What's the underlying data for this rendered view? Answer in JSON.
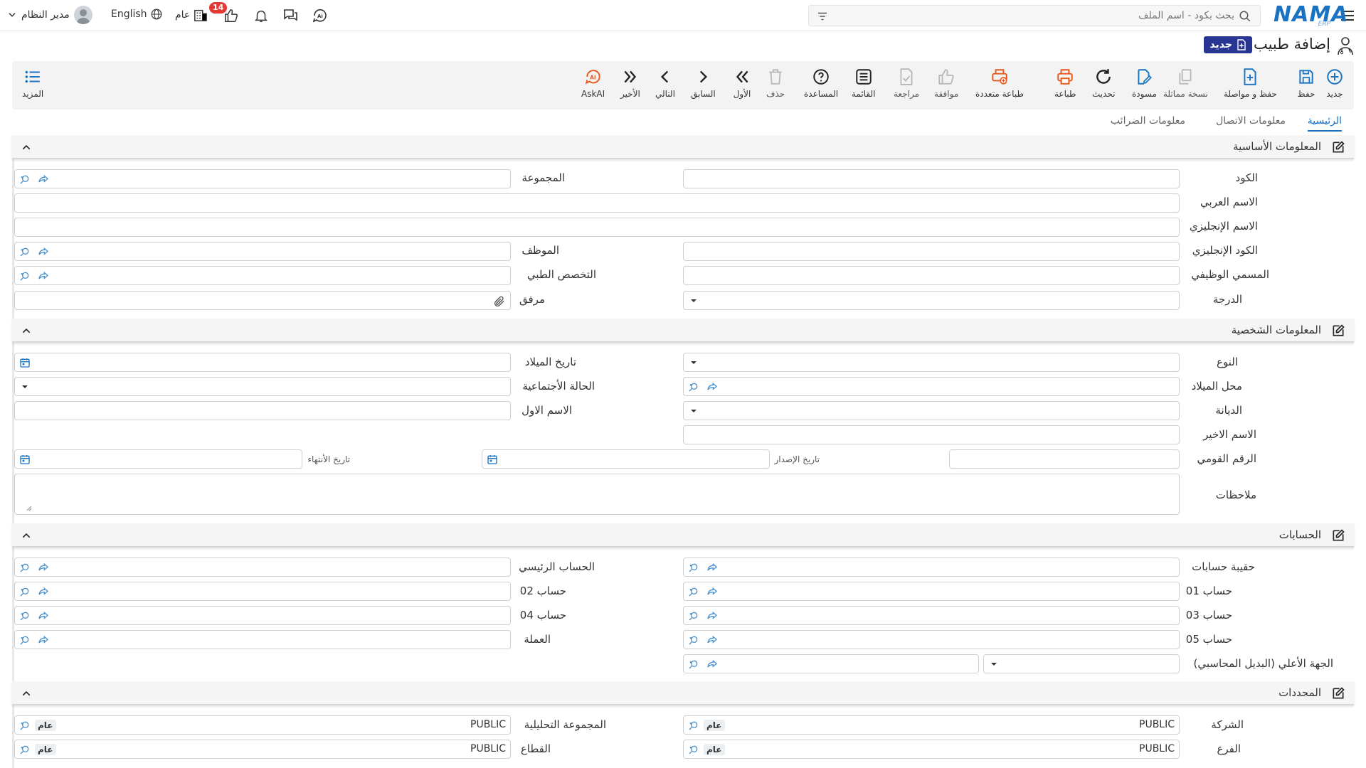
{
  "topbar": {
    "logo_text": "NAMA",
    "logo_sub": "ERP",
    "search_placeholder": "بحث بكود - اسم الملف",
    "notif_count": "14",
    "year_label": "عام",
    "language": "English",
    "user_name": "مدير النظام"
  },
  "page": {
    "title": "إضافة طبيب",
    "new_badge": "جديد"
  },
  "toolbar": {
    "new": "جديد",
    "save": "حفظ",
    "save_continue": "حفظ و مواصلة",
    "copy": "نسخة مماثلة",
    "draft": "مسودة",
    "refresh": "تحديث",
    "print": "طباعة",
    "multi_print": "طباعة متعددة",
    "approve": "موافقة",
    "review": "مراجعة",
    "list": "القائمة",
    "help": "المساعدة",
    "delete": "حذف",
    "first": "الأول",
    "previous": "السابق",
    "next": "التالي",
    "last": "الأخير",
    "askai": "AskAI",
    "more": "المزيد"
  },
  "tabs": [
    "الرئيسية",
    "معلومات الاتصال",
    "معلومات الضرائب"
  ],
  "sections": {
    "basic": "المعلومات الأساسية",
    "personal": "المعلومات الشخصية",
    "accounts": "الحسابات",
    "dimensions": "المحددات"
  },
  "basic_fields": {
    "code": "الكود",
    "group": "المجموعة",
    "arabic_name": "الاسم العربي",
    "english_name": "الاسم الإنجليزي",
    "english_code": "الكود الإنجليزي",
    "employee": "الموظف",
    "job_title": "المسمي الوظيفي",
    "specialty": "التخصص الطبي",
    "degree": "الدرجة",
    "attachment": "مرفق"
  },
  "personal_fields": {
    "gender": "النوع",
    "birth_date": "تاريخ الميلاد",
    "birth_place": "محل الميلاد",
    "marital_status": "الحالة الأجتماعية",
    "religion": "الديانة",
    "first_name": "الاسم الاول",
    "last_name": "الاسم الاخير",
    "national_id": "الرقم القومي",
    "issue_date": "تاريخ الإصدار",
    "expiry_date": "تاريخ الأنتهاء",
    "notes": "ملاحظات"
  },
  "account_fields": {
    "account_bag": "حقيبة حسابات",
    "main_account": "الحساب الرئيسي",
    "account01": "حساب 01",
    "account02": "حساب 02",
    "account03": "حساب 03",
    "account04": "حساب 04",
    "account05": "حساب 05",
    "currency": "العملة",
    "parent_entity": "الجهة الأعلي (البديل المحاسبي)"
  },
  "dimension_fields": {
    "company": "الشركة",
    "company_value": "PUBLIC",
    "company_tag": "عام",
    "analytic_group": "المجموعة التحليلية",
    "analytic_value": "PUBLIC",
    "analytic_tag": "عام",
    "branch": "الفرع",
    "branch_value": "PUBLIC",
    "branch_tag": "عام",
    "sector": "القطاع",
    "sector_value": "PUBLIC",
    "sector_tag": "عام"
  },
  "colors": {
    "brand": "#1a73c2",
    "badge_red": "#e53935",
    "new_badge_bg": "#283593",
    "orange": "#e8591e"
  }
}
